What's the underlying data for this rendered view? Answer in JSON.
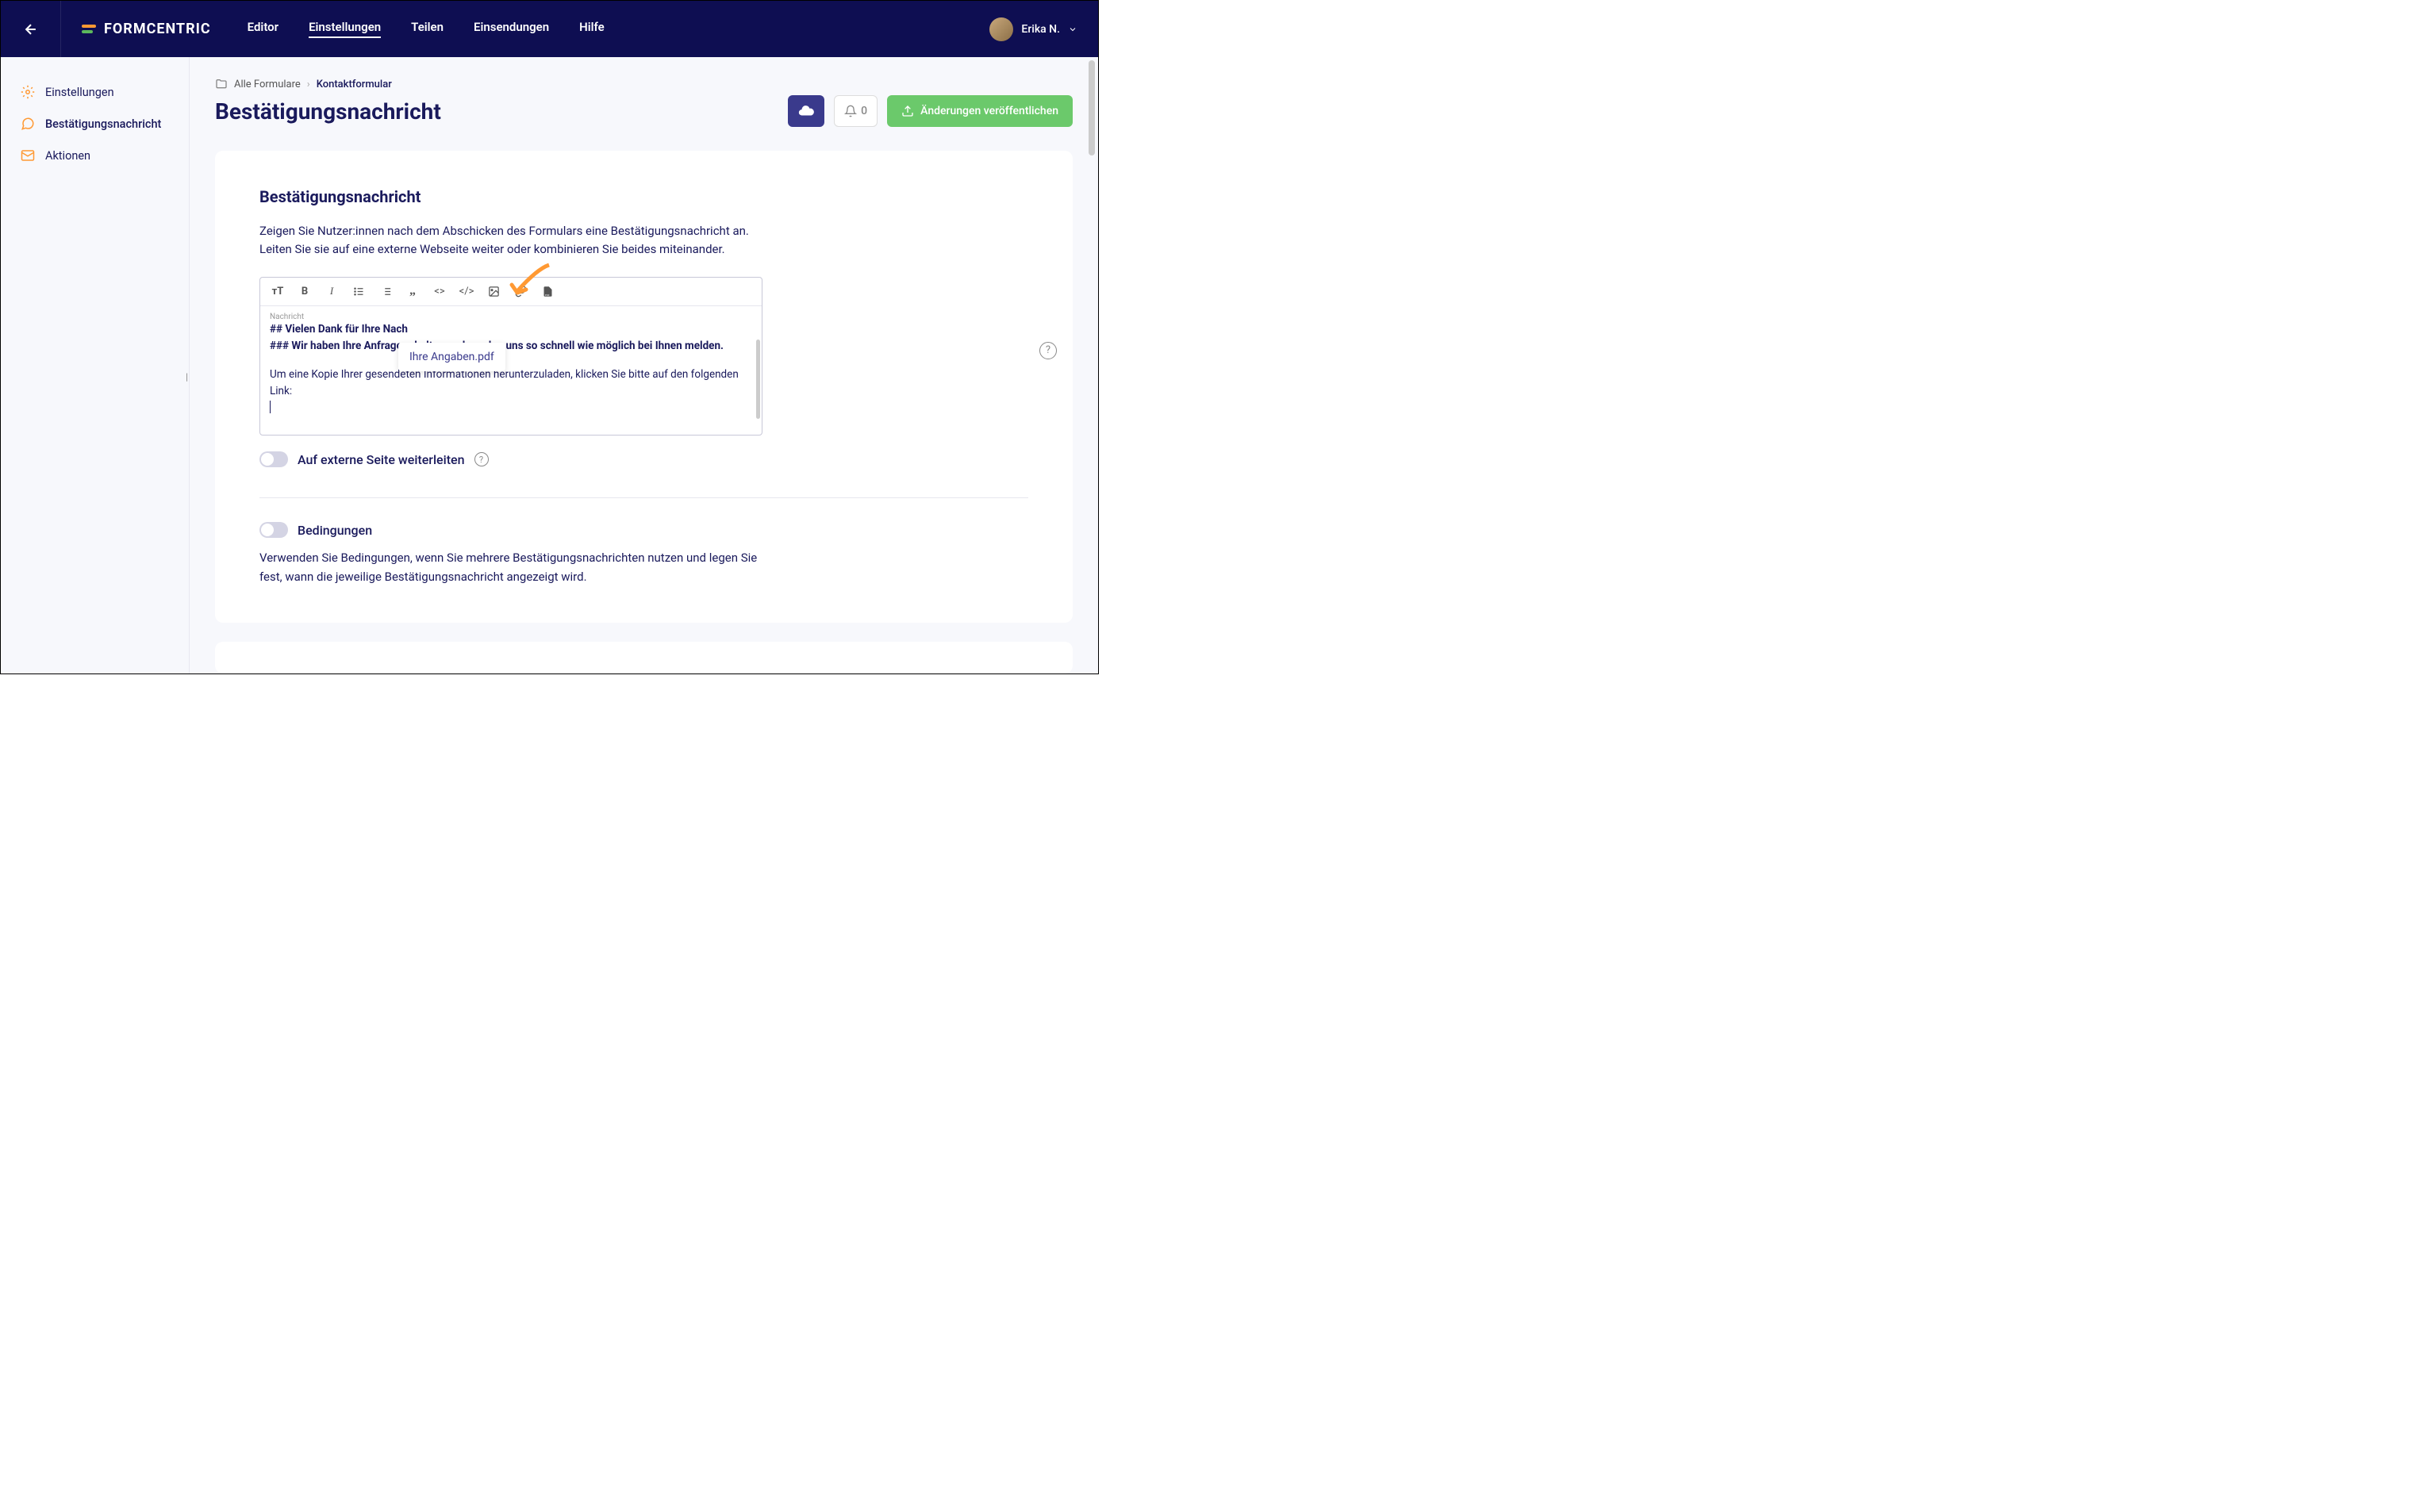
{
  "header": {
    "logo_text": "FORMCENTRIC",
    "nav": [
      "Editor",
      "Einstellungen",
      "Teilen",
      "Einsendungen",
      "Hilfe"
    ],
    "active_nav": 1,
    "user_name": "Erika N."
  },
  "sidebar": {
    "items": [
      {
        "label": "Einstellungen",
        "icon": "gear"
      },
      {
        "label": "Bestätigungsnachricht",
        "icon": "message"
      },
      {
        "label": "Aktionen",
        "icon": "mail"
      }
    ],
    "active": 1
  },
  "breadcrumbs": {
    "root": "Alle Formulare",
    "current": "Kontaktformular"
  },
  "page_title": "Bestätigungsnachricht",
  "notifications_count": "0",
  "publish_label": "Änderungen veröffentlichen",
  "card1": {
    "title": "Bestätigungsnachricht",
    "desc": "Zeigen Sie Nutzer:innen nach dem Abschicken des Formulars eine Bestätigungsnachricht an. Leiten Sie sie auf eine externe Webseite weiter oder kombinieren Sie beides miteinander.",
    "editor_label": "Nachricht",
    "line1": "## Vielen Dank für Ihre Nach",
    "line2": "### Wir haben Ihre Anfrage erhalten und werden uns so schnell wie möglich bei Ihnen melden.",
    "line3": "Um eine Kopie Ihrer gesendeten Informationen herunterzuladen, klicken Sie bitte auf den folgenden Link:",
    "tooltip": "Ihre Angaben.pdf",
    "toggle_redirect": "Auf externe Seite weiterleiten"
  },
  "card2": {
    "toggle": "Bedingungen",
    "desc": "Verwenden Sie Bedingungen, wenn Sie mehrere Bestätigungsnachrichten nutzen und legen Sie fest, wann die jeweilige Bestätigungsnachricht angezeigt wird."
  }
}
